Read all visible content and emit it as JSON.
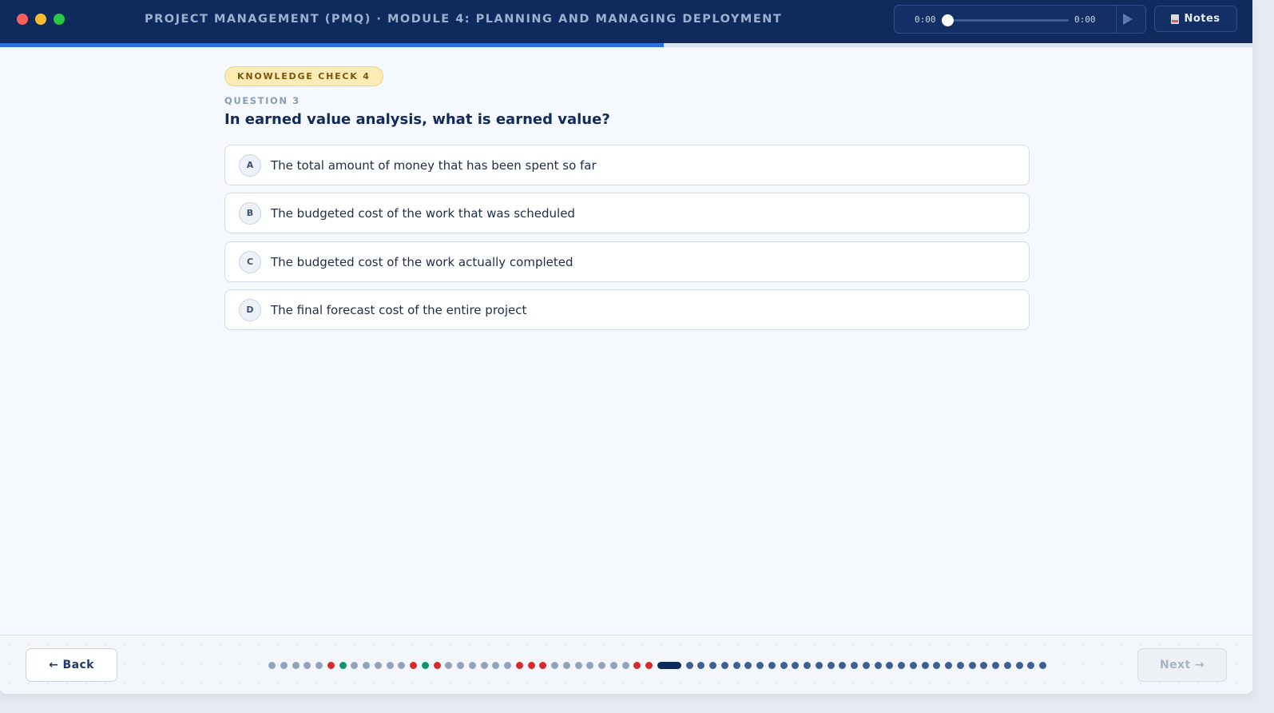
{
  "window": {
    "title": "PROJECT MANAGEMENT (PMQ) · MODULE 4: PLANNING AND MANAGING DEPLOYMENT"
  },
  "audio": {
    "current_time": "0:00",
    "duration": "0:00",
    "position_fraction": 0.0,
    "play_icon": "play-icon"
  },
  "toolbar": {
    "notes_label": "Notes",
    "notes_icon": "notes-icon"
  },
  "progress": {
    "fraction": 0.53
  },
  "quiz": {
    "badge": "KNOWLEDGE CHECK 4",
    "question_number": "QUESTION 3",
    "question": "In earned value analysis, what is earned value?",
    "options": [
      {
        "letter": "A",
        "text": "The total amount of money that has been spent so far"
      },
      {
        "letter": "B",
        "text": "The budgeted cost of the work that was scheduled"
      },
      {
        "letter": "C",
        "text": "The budgeted cost of the work actually completed"
      },
      {
        "letter": "D",
        "text": "The final forecast cost of the entire project"
      }
    ]
  },
  "footer": {
    "back_label": "← Back",
    "next_label": "Next →",
    "slides": [
      "seen",
      "seen",
      "seen",
      "seen",
      "seen",
      "wrong",
      "right",
      "seen",
      "seen",
      "seen",
      "seen",
      "seen",
      "wrong",
      "right",
      "wrong",
      "seen",
      "seen",
      "seen",
      "seen",
      "seen",
      "seen",
      "wrong",
      "wrong",
      "wrong",
      "seen",
      "seen",
      "seen",
      "seen",
      "seen",
      "seen",
      "seen",
      "wrong",
      "wrong",
      "current",
      "todo",
      "todo",
      "todo",
      "todo",
      "todo",
      "todo",
      "todo",
      "todo",
      "todo",
      "todo",
      "todo",
      "todo",
      "todo",
      "todo",
      "todo",
      "todo",
      "todo",
      "todo",
      "todo",
      "todo",
      "todo",
      "todo",
      "todo",
      "todo",
      "todo",
      "todo",
      "todo",
      "todo",
      "todo",
      "todo",
      "todo"
    ]
  },
  "colors": {
    "header_bg": "#0f2a5c",
    "accent": "#2f6fe0",
    "wrong": "#d62b2b",
    "correct": "#12946b",
    "badge_bg": "#fcebb4"
  }
}
